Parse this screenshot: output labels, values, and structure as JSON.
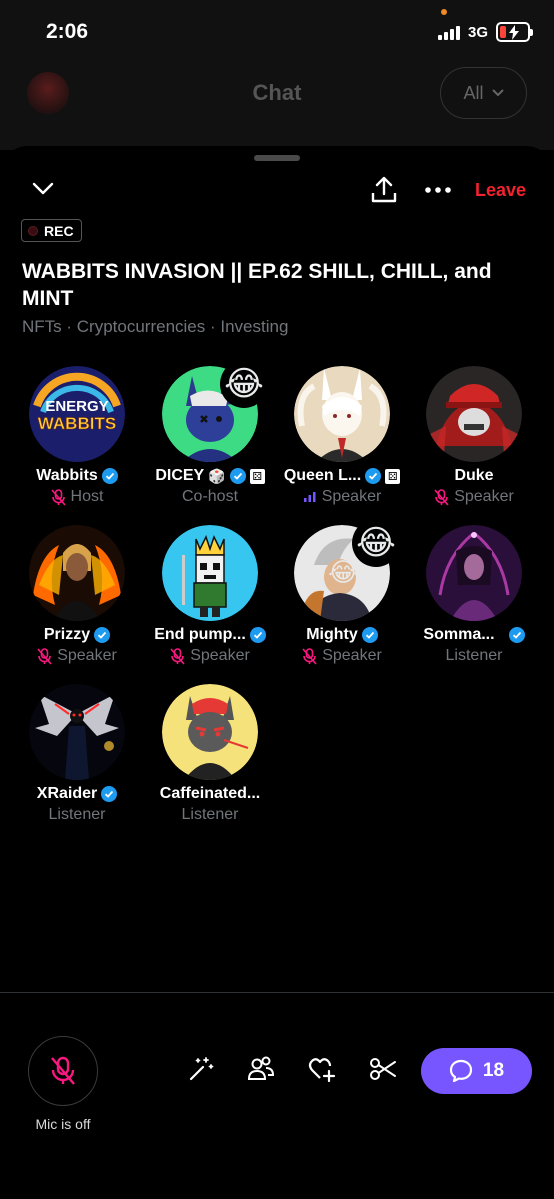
{
  "status_bar": {
    "time": "2:06",
    "network": "3G"
  },
  "background_header": {
    "title": "Chat",
    "filter_label": "All"
  },
  "topbar": {
    "leave_label": "Leave"
  },
  "space": {
    "rec_label": "REC",
    "title": "WABBITS INVASION || EP.62 SHILL, CHILL, and MINT",
    "topics": "NFTs · Cryptocurrencies · Investing"
  },
  "participants": [
    {
      "name": "Wabbits",
      "role": "Host",
      "verified": true,
      "muted": true
    },
    {
      "name": "DICEY",
      "role": "Co-host",
      "verified": true,
      "muted": false,
      "emoji": "😂"
    },
    {
      "name": "Queen L...",
      "role": "Speaker",
      "verified": true,
      "muted": false,
      "speaking": true
    },
    {
      "name": "Duke",
      "role": "Speaker",
      "verified": false,
      "muted": true
    },
    {
      "name": "Prizzy",
      "role": "Speaker",
      "verified": true,
      "muted": true
    },
    {
      "name": "End pump...",
      "role": "Speaker",
      "verified": true,
      "muted": true
    },
    {
      "name": "Mighty",
      "role": "Speaker",
      "verified": true,
      "muted": true,
      "emoji": "😂"
    },
    {
      "name": "Somma...",
      "role": "Listener",
      "verified": true,
      "muted": false
    },
    {
      "name": "XRaider",
      "role": "Listener",
      "verified": true,
      "muted": false
    },
    {
      "name": "Caffeinated...",
      "role": "Listener",
      "verified": false,
      "muted": false
    }
  ],
  "bottom": {
    "mic_label": "Mic is off",
    "chat_count": "18"
  },
  "colors": {
    "accent_purple": "#7856ff",
    "leave_red": "#f4212e",
    "verified_blue": "#1d9bf0",
    "muted_pink": "#f91880"
  }
}
